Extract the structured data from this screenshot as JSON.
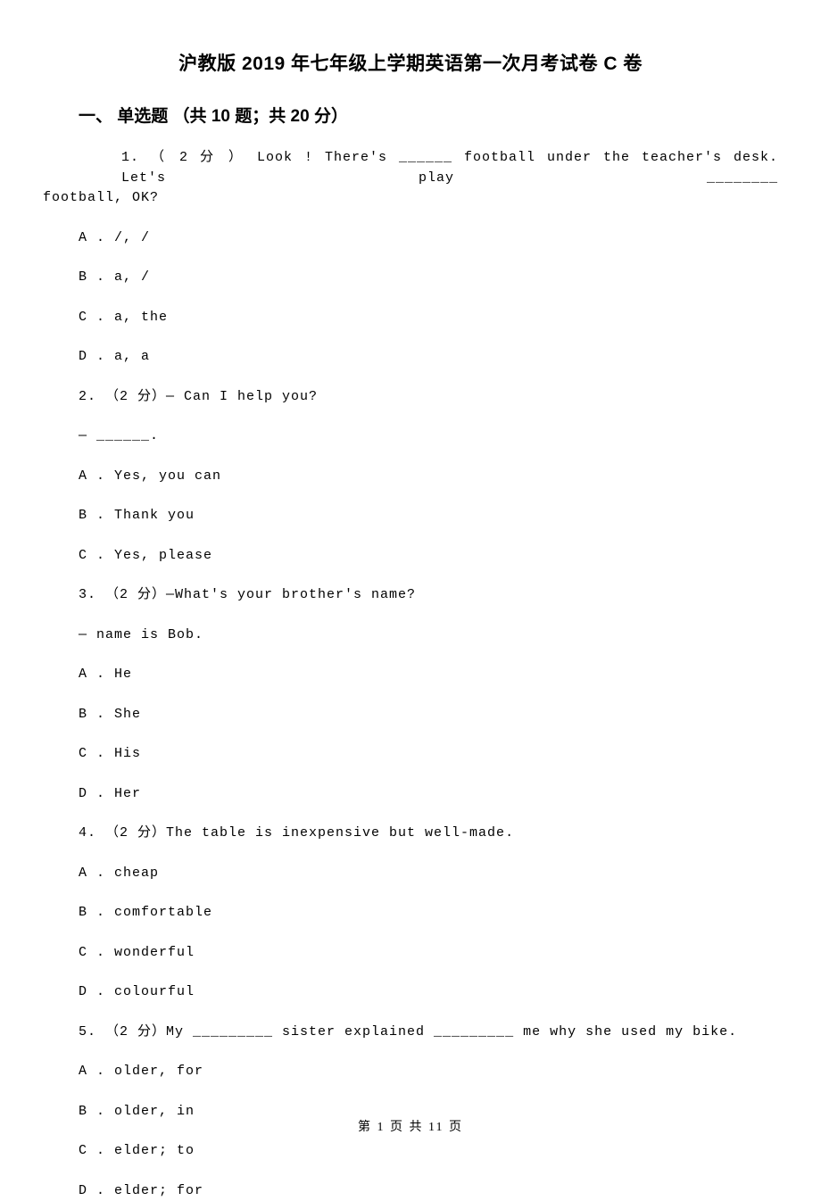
{
  "title": "沪教版 2019 年七年级上学期英语第一次月考试卷 C 卷",
  "section_heading": "一、 单选题 （共 10 题；共 20 分）",
  "q1": {
    "line1": "1. （ 2 分 ） Look  !  There's  ______  football  under  the  teacher's desk.  Let's  play  ________",
    "line2": "football, OK?",
    "a": "A . /, /",
    "b": "B . a, /",
    "c": "C . a, the",
    "d": "D . a, a"
  },
  "q2": {
    "stem": "2.  （2 分）— Can I help you?",
    "follow": "— ______.",
    "a": "A . Yes, you can",
    "b": "B . Thank you",
    "c": "C . Yes, please"
  },
  "q3": {
    "stem": "3.  （2 分）—What's your brother's name?",
    "follow": "—        name is Bob.",
    "a": "A . He",
    "b": "B . She",
    "c": "C . His",
    "d": "D . Her"
  },
  "q4": {
    "stem": "4.  （2 分）The table is inexpensive but well-made.",
    "a": "A . cheap",
    "b": "B . comfortable",
    "c": "C . wonderful",
    "d": "D . colourful"
  },
  "q5": {
    "stem": "5.  （2 分）My _________ sister explained _________ me why she used my bike.",
    "a": "A . older, for",
    "b": "B . older, in",
    "c": "C . elder; to",
    "d": "D . elder; for"
  },
  "footer": "第 1 页 共 11 页"
}
